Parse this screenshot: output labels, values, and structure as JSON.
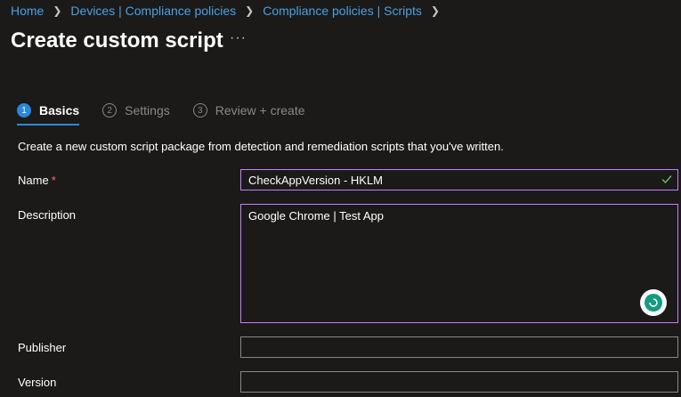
{
  "breadcrumb": {
    "items": [
      "Home",
      "Devices | Compliance policies",
      "Compliance policies | Scripts"
    ],
    "separator_icon": "chevron-right-icon"
  },
  "header": {
    "title": "Create custom script",
    "more_label": "···"
  },
  "steps": [
    {
      "number": "1",
      "label": "Basics",
      "state": "active"
    },
    {
      "number": "2",
      "label": "Settings",
      "state": "inactive"
    },
    {
      "number": "3",
      "label": "Review + create",
      "state": "inactive"
    }
  ],
  "form": {
    "intro": "Create a new custom script package from detection and remediation scripts that you've written.",
    "name": {
      "label": "Name",
      "required_mark": "*",
      "value": "CheckAppVersion - HKLM",
      "valid_icon": "checkmark-icon"
    },
    "description": {
      "label": "Description",
      "value": "Google Chrome | Test App"
    },
    "publisher": {
      "label": "Publisher",
      "value": ""
    },
    "version": {
      "label": "Version",
      "value": ""
    }
  },
  "colors": {
    "background": "#1b1a19",
    "link": "#4aa0e6",
    "accent": "#2b88d8",
    "focus_border": "#c77dff",
    "required": "#ff6b6b",
    "valid": "#6bbf59"
  }
}
